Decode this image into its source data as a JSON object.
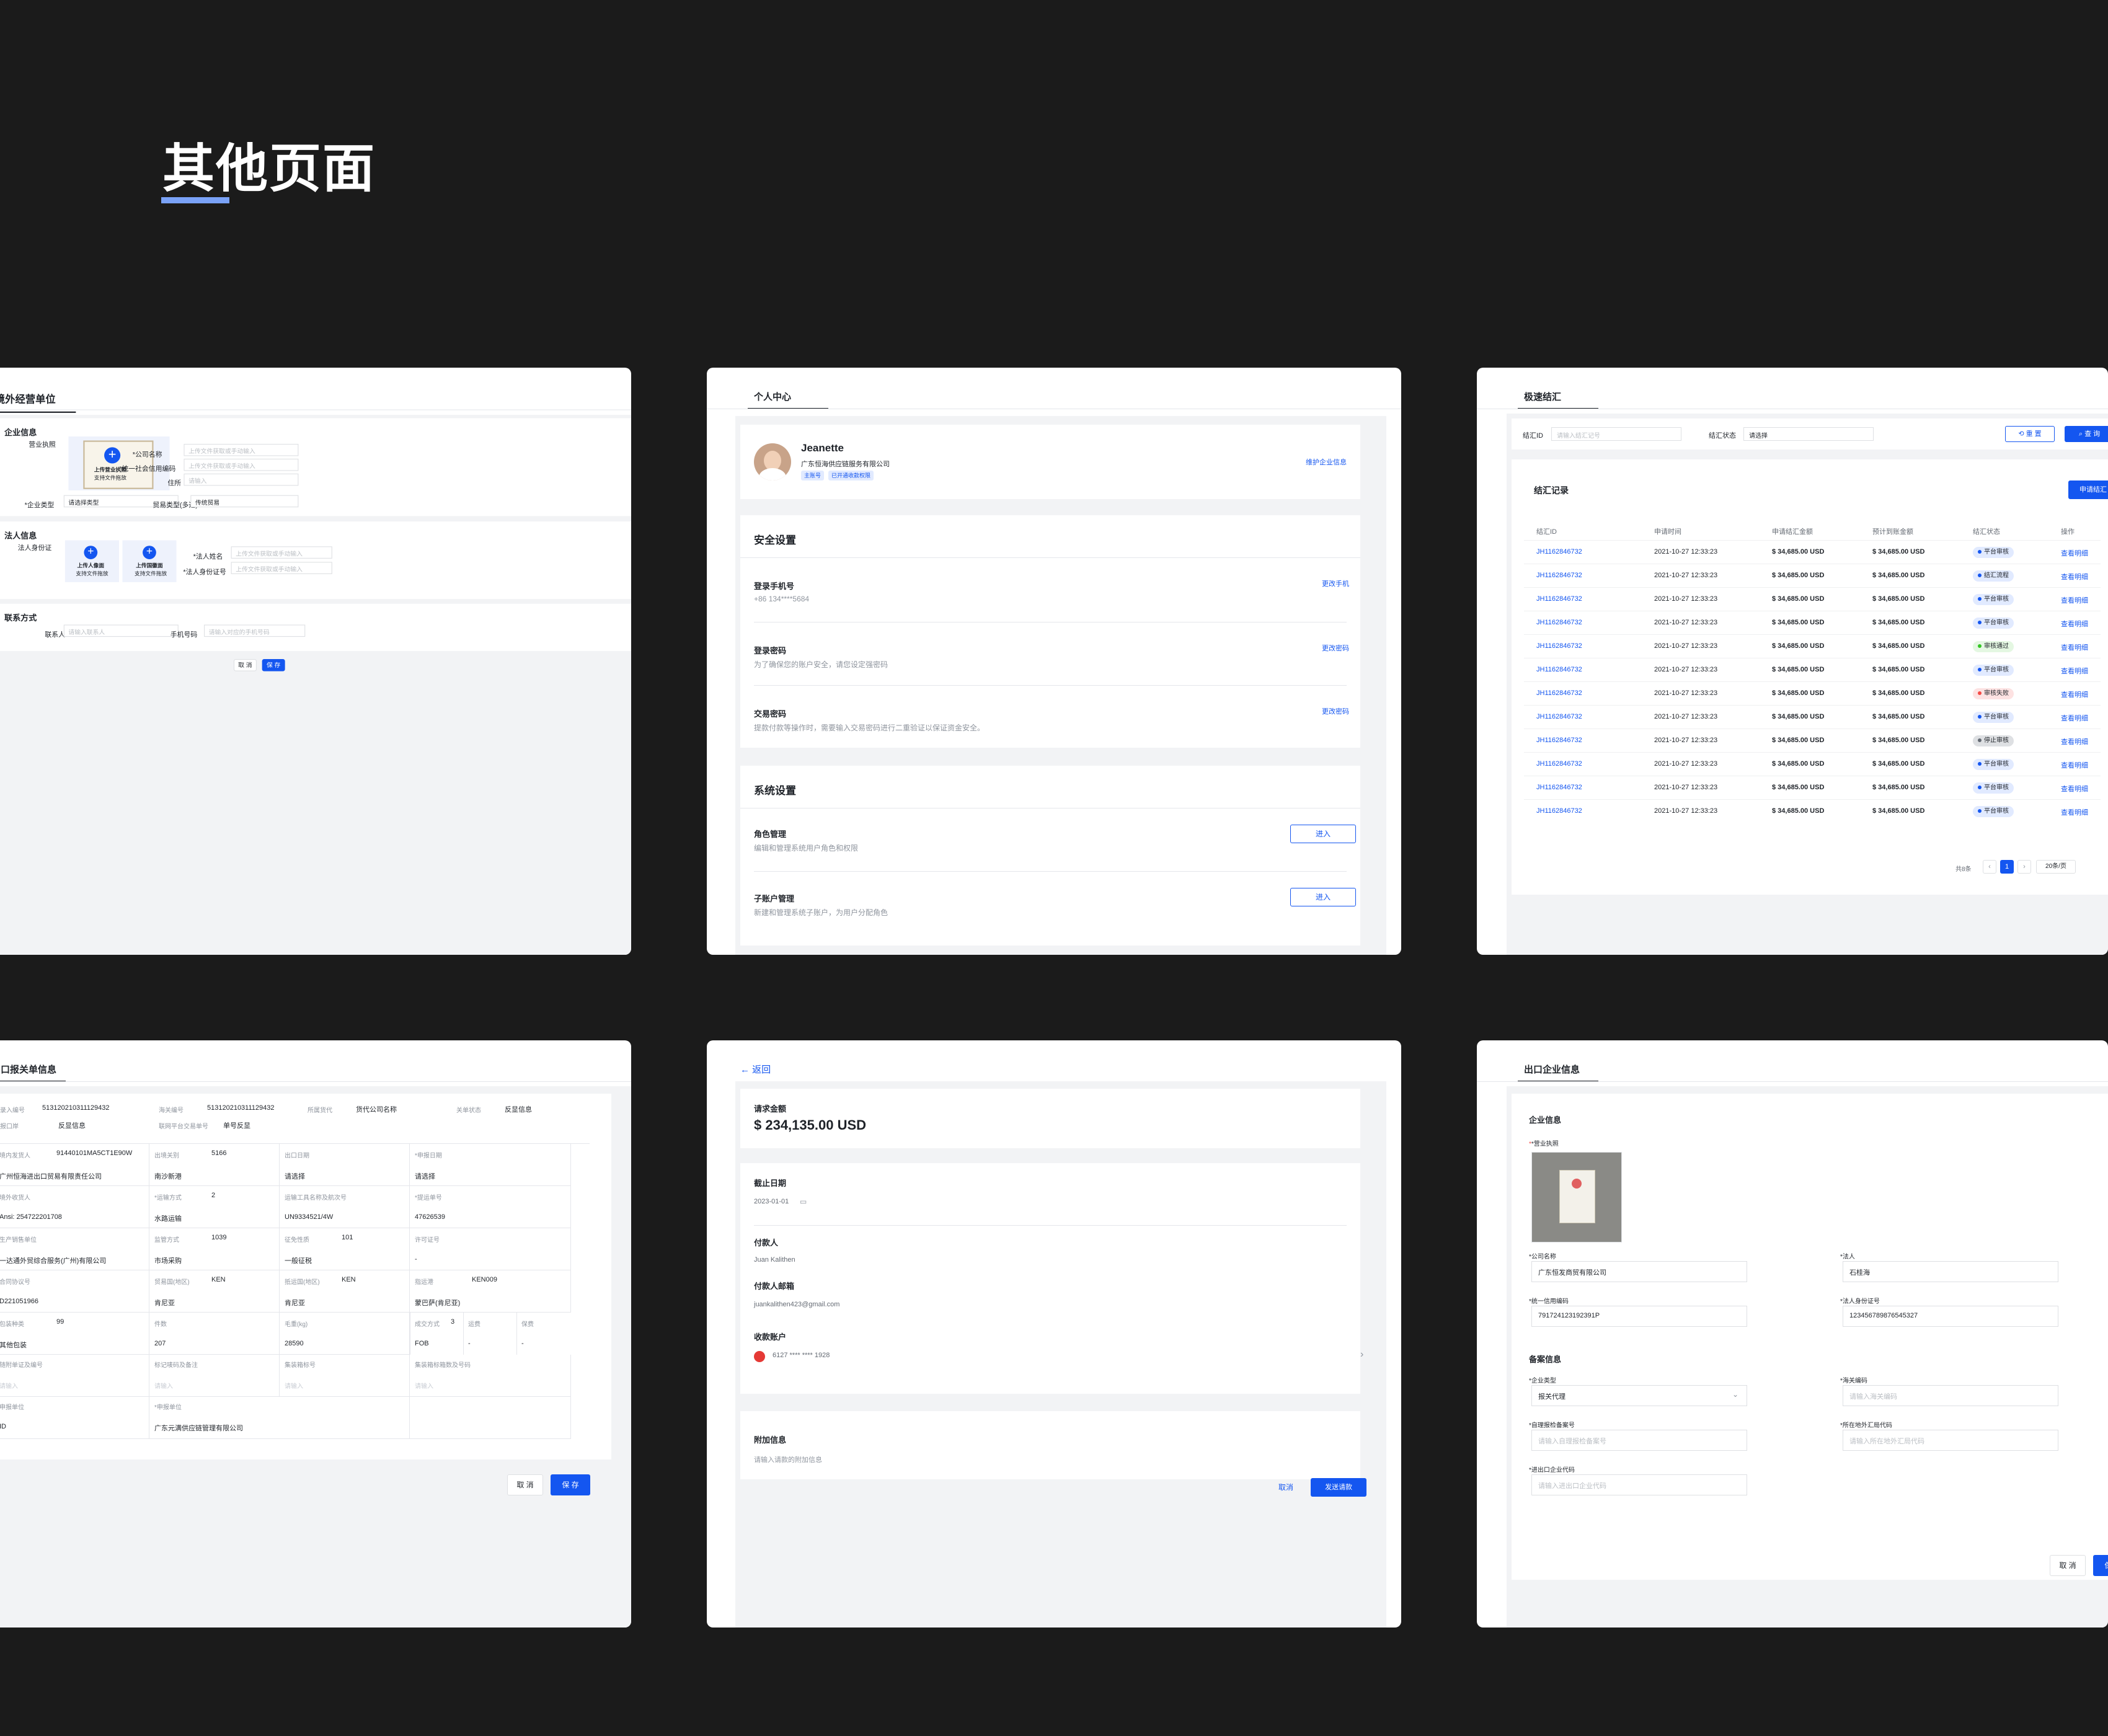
{
  "page_title": "其他页面",
  "p1": {
    "title": "境外经营单位",
    "sec1": "企业信息",
    "license_label": "营业执照",
    "upload_license": "上传营业执照",
    "support": "支持文件拖放",
    "company_name_label": "*公司名称",
    "company_name_ph": "上传文件获取或手动输入",
    "credit_code_label": "*统一社会信用编码",
    "credit_code_ph": "上传文件获取或手动输入",
    "address_label": "住所",
    "address_ph": "请输入",
    "ent_type_label": "*企业类型",
    "ent_type_value": "请选择类型",
    "trade_type_label": "贸易类型(多选)",
    "trade_type_value": "传统贸易",
    "sec2": "法人信息",
    "id_label": "法人身份证",
    "upload_portrait": "上传人像面",
    "upload_emblem": "上传国徽面",
    "legal_name_label": "*法人姓名",
    "legal_name_ph": "上传文件获取或手动输入",
    "legal_id_label": "*法人身份证号",
    "legal_id_ph": "上传文件获取或手动输入",
    "sec3": "联系方式",
    "contact_label": "联系人",
    "contact_ph": "请输入联系人",
    "phone_label": "手机号码",
    "phone_ph": "请输入对应的手机号码",
    "cancel": "取 消",
    "save": "保 存"
  },
  "p2": {
    "title": "个人中心",
    "user_name": "Jeanette",
    "company": "广东恒海供应链服务有限公司",
    "tag1": "主账号",
    "tag2": "已开通收款权限",
    "maintain_link": "维护企业信息",
    "security_title": "安全设置",
    "phone_title": "登录手机号",
    "phone_value": "+86 134****5684",
    "phone_action": "更改手机",
    "pwd_title": "登录密码",
    "pwd_desc": "为了确保您的账户安全，请您设定强密码",
    "pwd_action": "更改密码",
    "tx_title": "交易密码",
    "tx_desc": "提款付款等操作时，需要输入交易密码进行二重验证以保证资金安全。",
    "tx_action": "更改密码",
    "system_title": "系统设置",
    "role_title": "角色管理",
    "role_desc": "编辑和管理系统用户角色和权限",
    "sub_title": "子账户管理",
    "sub_desc": "新建和管理系统子账户，为用户分配角色",
    "enter": "进入"
  },
  "p3": {
    "title": "极速结汇",
    "filter_id_label": "结汇ID",
    "filter_id_ph": "请输入结汇记号",
    "filter_status_label": "结汇状态",
    "filter_status_value": "请选择",
    "reset": "重 置",
    "search": "查 询",
    "records_title": "结汇记录",
    "apply": "申请结汇",
    "columns": [
      "结汇ID",
      "申请时间",
      "申请结汇金额",
      "预计到账金额",
      "结汇状态",
      "操作"
    ],
    "rows": [
      {
        "id": "JH1162846732",
        "time": "2021-10-27 12:33:23",
        "amount": "$ 34,685.00 USD",
        "expect": "$ 34,685.00 USD",
        "status": "平台审核",
        "action": "查看明细"
      },
      {
        "id": "JH1162846732",
        "time": "2021-10-27 12:33:23",
        "amount": "$ 34,685.00 USD",
        "expect": "$ 34,685.00 USD",
        "status": "结汇流程",
        "action": "查看明细"
      },
      {
        "id": "JH1162846732",
        "time": "2021-10-27 12:33:23",
        "amount": "$ 34,685.00 USD",
        "expect": "$ 34,685.00 USD",
        "status": "平台审核",
        "action": "查看明细"
      },
      {
        "id": "JH1162846732",
        "time": "2021-10-27 12:33:23",
        "amount": "$ 34,685.00 USD",
        "expect": "$ 34,685.00 USD",
        "status": "平台审核",
        "action": "查看明细"
      },
      {
        "id": "JH1162846732",
        "time": "2021-10-27 12:33:23",
        "amount": "$ 34,685.00 USD",
        "expect": "$ 34,685.00 USD",
        "status": "审核通过",
        "action": "查看明细"
      },
      {
        "id": "JH1162846732",
        "time": "2021-10-27 12:33:23",
        "amount": "$ 34,685.00 USD",
        "expect": "$ 34,685.00 USD",
        "status": "平台审核",
        "action": "查看明细"
      },
      {
        "id": "JH1162846732",
        "time": "2021-10-27 12:33:23",
        "amount": "$ 34,685.00 USD",
        "expect": "$ 34,685.00 USD",
        "status": "审核失败",
        "action": "查看明细"
      },
      {
        "id": "JH1162846732",
        "time": "2021-10-27 12:33:23",
        "amount": "$ 34,685.00 USD",
        "expect": "$ 34,685.00 USD",
        "status": "平台审核",
        "action": "查看明细"
      },
      {
        "id": "JH1162846732",
        "time": "2021-10-27 12:33:23",
        "amount": "$ 34,685.00 USD",
        "expect": "$ 34,685.00 USD",
        "status": "停止审核",
        "action": "查看明细"
      },
      {
        "id": "JH1162846732",
        "time": "2021-10-27 12:33:23",
        "amount": "$ 34,685.00 USD",
        "expect": "$ 34,685.00 USD",
        "status": "平台审核",
        "action": "查看明细"
      },
      {
        "id": "JH1162846732",
        "time": "2021-10-27 12:33:23",
        "amount": "$ 34,685.00 USD",
        "expect": "$ 34,685.00 USD",
        "status": "平台审核",
        "action": "查看明细"
      },
      {
        "id": "JH1162846732",
        "time": "2021-10-27 12:33:23",
        "amount": "$ 34,685.00 USD",
        "expect": "$ 34,685.00 USD",
        "status": "平台审核",
        "action": "查看明细"
      }
    ],
    "status_colors": {
      "平台审核": "#1456f0",
      "结汇流程": "#1456f0",
      "审核通过": "#34c724",
      "审核失败": "#f54a45",
      "停止审核": "#646a73"
    },
    "total": "共8条",
    "page": "1",
    "page_size": "20条/页"
  },
  "p4": {
    "title": "出口报关单信息",
    "top": [
      {
        "label": "预录入编号",
        "value": "513120210311129432"
      },
      {
        "label": "海关编号",
        "value": "513120210311129432"
      },
      {
        "label": "所属货代",
        "value": "货代公司名称"
      },
      {
        "label": "关单状态",
        "value": "反显信息"
      }
    ],
    "top2": [
      {
        "label": "申报口岸",
        "value": "反显信息"
      },
      {
        "label": "联网平台交易单号",
        "value": "单号反显"
      }
    ],
    "rows": [
      [
        {
          "label": "境内发货人",
          "value": "91440101MA5CT1E90W"
        },
        {
          "label": "出境关别",
          "value": "5166"
        },
        {
          "label": "出口日期",
          "value": ""
        },
        {
          "label": "*申报日期",
          "value": ""
        }
      ],
      [
        {
          "label": "",
          "value": "广州恒海进出口贸易有限责任公司"
        },
        {
          "label": "",
          "value": "南沙新港"
        },
        {
          "label": "",
          "value": "请选择"
        },
        {
          "label": "",
          "value": "请选择"
        }
      ],
      [
        {
          "label": "境外收货人",
          "value": ""
        },
        {
          "label": "*运输方式",
          "value": "2"
        },
        {
          "label": "运输工具名称及航次号",
          "value": ""
        },
        {
          "label": "*提运单号",
          "value": ""
        }
      ],
      [
        {
          "label": "",
          "value": "Ansi: 254722201708"
        },
        {
          "label": "",
          "value": "水路运输"
        },
        {
          "label": "",
          "value": "UN9334521/4W"
        },
        {
          "label": "",
          "value": "47626539"
        }
      ],
      [
        {
          "label": "生产销售单位",
          "value": ""
        },
        {
          "label": "监管方式",
          "value": "1039"
        },
        {
          "label": "征免性质",
          "value": "101"
        },
        {
          "label": "许可证号",
          "value": ""
        }
      ],
      [
        {
          "label": "",
          "value": "一达通外贸综合服务(广州)有限公司"
        },
        {
          "label": "",
          "value": "市场采购"
        },
        {
          "label": "",
          "value": "一般征税"
        },
        {
          "label": "",
          "value": "-"
        }
      ],
      [
        {
          "label": "合同协议号",
          "value": ""
        },
        {
          "label": "贸易国(地区)",
          "value": "KEN"
        },
        {
          "label": "抵运国(地区)",
          "value": "KEN"
        },
        {
          "label": "指运港",
          "value": "KEN009"
        }
      ],
      [
        {
          "label": "",
          "value": "D221051966"
        },
        {
          "label": "",
          "value": "肯尼亚"
        },
        {
          "label": "",
          "value": "肯尼亚"
        },
        {
          "label": "",
          "value": "蒙巴萨(肯尼亚)"
        }
      ],
      [
        {
          "label": "包装种类",
          "value": "99"
        },
        {
          "label": "件数",
          "value": ""
        },
        {
          "label": "毛重(kg)",
          "value": ""
        },
        {
          "label": "净重(kg)",
          "value": ""
        }
      ],
      [
        {
          "label": "",
          "value": "其他包装"
        },
        {
          "label": "",
          "value": "207"
        },
        {
          "label": "",
          "value": "28590"
        },
        {
          "label": "",
          "value": "28333"
        }
      ]
    ],
    "extra": [
      {
        "label": "成交方式",
        "value": "3"
      },
      {
        "label": "",
        "value": "FOB"
      },
      {
        "label": "运费",
        "value": ""
      },
      {
        "label": "",
        "value": "-"
      },
      {
        "label": "保费",
        "value": ""
      },
      {
        "label": "",
        "value": "-"
      }
    ],
    "row_docs": [
      {
        "label": "随附单证及编号",
        "ph": "请输入"
      },
      {
        "label": "标记唛码及备注",
        "ph": "请输入"
      },
      {
        "label": "集装箱标号",
        "ph": "请输入"
      },
      {
        "label": "集装箱标箱数及号码",
        "ph": "请输入"
      }
    ],
    "last": [
      {
        "label": "申报单位",
        "value": "ID"
      },
      {
        "label": "*申报单位",
        "value": "广东元满供应链管理有限公司"
      }
    ],
    "cancel": "取 消",
    "save": "保 存"
  },
  "p5": {
    "back": "返回",
    "amount_label": "请求金额",
    "amount_value": "$ 234,135.00 USD",
    "due_label": "截止日期",
    "due_value": "2023-01-01",
    "payer_label": "付款人",
    "payer_value": "Juan Kalithen",
    "email_label": "付款人邮箱",
    "email_value": "juankalithen423@gmail.com",
    "account_label": "收款账户",
    "account_value": "6127 **** **** 1928",
    "extra_label": "附加信息",
    "extra_ph": "请输入请款的附加信息",
    "cancel": "取消",
    "send": "发送请款"
  },
  "p6": {
    "title": "出口企业信息",
    "sec1": "企业信息",
    "license_label": "*营业执照",
    "company_label": "*公司名称",
    "company_value": "广东恒发商贸有限公司",
    "legal_label": "*法人",
    "legal_value": "石桂海",
    "credit_label": "*统一信用编码",
    "credit_value": "791724123192391P",
    "legal_id_label": "*法人身份证号",
    "legal_id_value": "123456789876545327",
    "sec2": "备案信息",
    "type_label": "*企业类型",
    "type_value": "报关代理",
    "customs_label": "*海关编码",
    "customs_ph": "请输入海关编码",
    "inspect_label": "*自理报检备案号",
    "inspect_ph": "请输入自理报检备案号",
    "forex_label": "*所在地外汇局代码",
    "forex_ph": "请输入所在地外汇局代码",
    "ie_label": "*进出口企业代码",
    "ie_ph": "请输入进出口企业代码",
    "cancel": "取 消",
    "save": "保 存"
  }
}
